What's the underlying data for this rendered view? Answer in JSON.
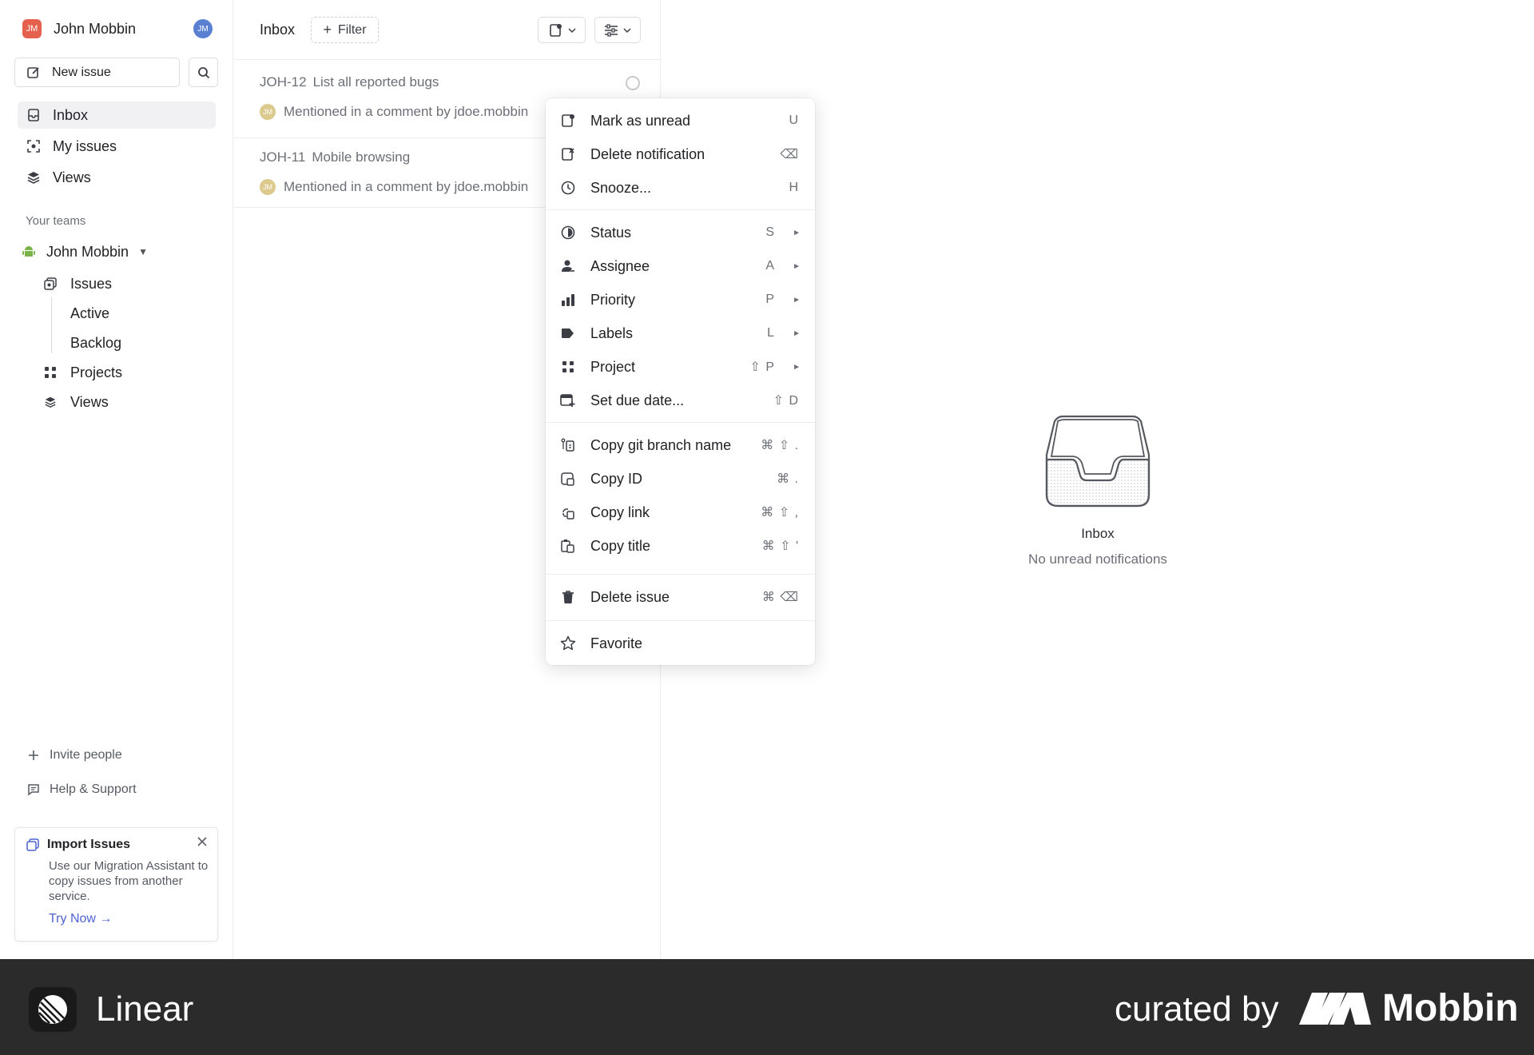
{
  "sidebar": {
    "workspace_initials": "JM",
    "workspace_name": "John Mobbin",
    "user_initials": "JM",
    "new_issue_label": "New issue",
    "nav": [
      {
        "label": "Inbox"
      },
      {
        "label": "My issues"
      },
      {
        "label": "Views"
      }
    ],
    "teams_title": "Your teams",
    "team_name": "John Mobbin",
    "team_items": [
      {
        "label": "Issues"
      },
      {
        "label": "Active"
      },
      {
        "label": "Backlog"
      },
      {
        "label": "Projects"
      },
      {
        "label": "Views"
      }
    ],
    "invite_label": "Invite people",
    "help_label": "Help & Support",
    "import_card": {
      "title": "Import Issues",
      "body": "Use our Migration Assistant to copy issues from another service.",
      "cta": "Try Now →"
    }
  },
  "inbox": {
    "title": "Inbox",
    "filter_label": "Filter",
    "notifications": [
      {
        "id": "JOH-12",
        "title": "List all reported bugs",
        "avatar": "JM",
        "detail": "Mentioned in a comment by jdoe.mobbin"
      },
      {
        "id": "JOH-11",
        "title": "Mobile browsing",
        "avatar": "JM",
        "detail": "Mentioned in a comment by jdoe.mobbin"
      }
    ]
  },
  "context_menu": {
    "items": [
      {
        "label": "Mark as unread",
        "shortcut": "U",
        "icon": "mark-unread-icon"
      },
      {
        "label": "Delete notification",
        "shortcut": "⌫",
        "icon": "delete-notification-icon"
      },
      {
        "label": "Snooze...",
        "shortcut": "H",
        "icon": "clock-icon"
      },
      {
        "label": "Status",
        "shortcut": "S",
        "icon": "status-icon"
      },
      {
        "label": "Assignee",
        "shortcut": "A",
        "icon": "assignee-icon"
      },
      {
        "label": "Priority",
        "shortcut": "P",
        "icon": "priority-icon"
      },
      {
        "label": "Labels",
        "shortcut": "L",
        "icon": "label-icon"
      },
      {
        "label": "Project",
        "shortcut": "⇧ P",
        "icon": "project-icon"
      },
      {
        "label": "Set due date...",
        "shortcut": "⇧ D",
        "icon": "calendar-icon"
      },
      {
        "label": "Copy git branch name",
        "shortcut": "⌘ ⇧ .",
        "icon": "git-branch-icon"
      },
      {
        "label": "Copy ID",
        "shortcut": "⌘ .",
        "icon": "copy-id-icon"
      },
      {
        "label": "Copy link",
        "shortcut": "⌘ ⇧ ,",
        "icon": "copy-link-icon"
      },
      {
        "label": "Copy title",
        "shortcut": "⌘ ⇧ '",
        "icon": "copy-title-icon"
      },
      {
        "label": "Delete issue",
        "shortcut": "⌘ ⌫",
        "icon": "trash-icon"
      },
      {
        "label": "Favorite",
        "shortcut": "",
        "icon": "star-icon"
      }
    ]
  },
  "empty_state": {
    "title": "Inbox",
    "subtitle": "No unread notifications"
  },
  "footer": {
    "brand": "Linear",
    "curated_by": "curated by",
    "curator": "Mobbin"
  },
  "colors": {
    "accent": "#4d62d1",
    "workspace_logo": "#e5604d",
    "user_avatar": "#5b7fd1",
    "footer_bg": "#2b2b2b"
  }
}
